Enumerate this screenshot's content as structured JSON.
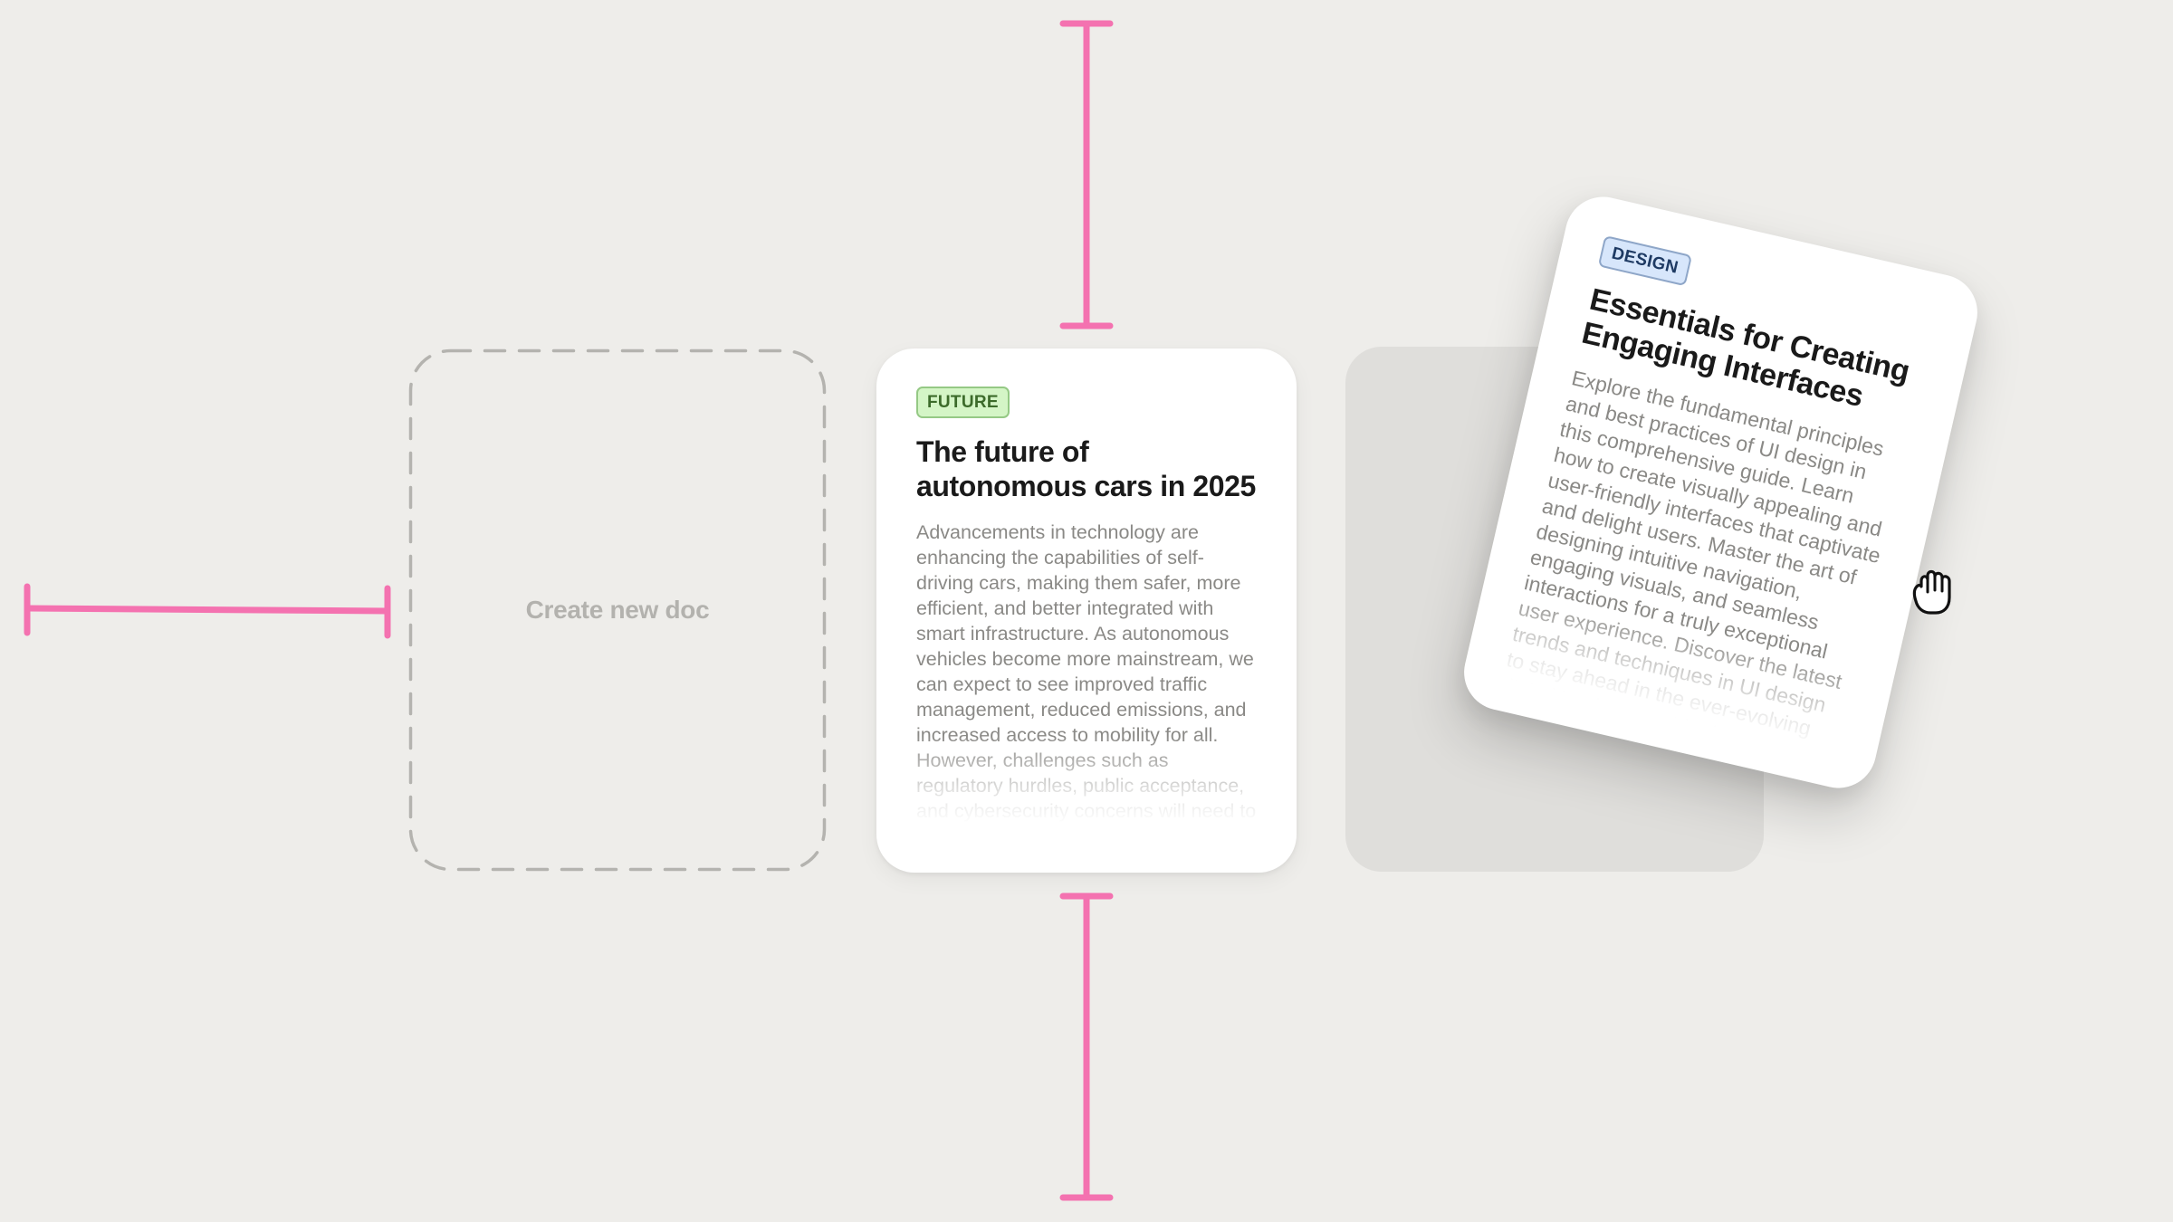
{
  "canvas": {
    "background_color": "#eeedea",
    "guide_color": "#f472b0"
  },
  "create_slot": {
    "label": "Create new doc"
  },
  "cards": [
    {
      "tag": "FUTURE",
      "tag_color": "#3c6b2a",
      "tag_background": "#d4f5c6",
      "title": "The future of autonomous cars in 2025",
      "body": "Advancements in technology are enhancing the capabilities of self-driving cars, making them safer, more efficient, and better integrated with smart infrastructure. As autonomous vehicles become more mainstream, we can expect to see improved traffic management, reduced emissions, and increased access to mobility for all. However, challenges such as regulatory hurdles, public acceptance, and cybersecurity concerns will need to be addressed..."
    },
    {
      "tag": "DESIGN",
      "tag_color": "#1e3a63",
      "tag_background": "#d7e6fb",
      "title": "Essentials for Creating Engaging Interfaces",
      "body": "Explore the fundamental principles and best practices of UI design in this comprehensive guide. Learn how to create visually appealing and user-friendly interfaces that captivate and delight users. Master the art of designing intuitive navigation, engaging visuals, and seamless interactions for a truly exceptional user experience. Discover the latest trends and techniques in UI design to stay ahead in the ever-evolving digital landscape. Whether..."
    }
  ],
  "cursor": {
    "icon": "grabbing-hand-icon"
  }
}
